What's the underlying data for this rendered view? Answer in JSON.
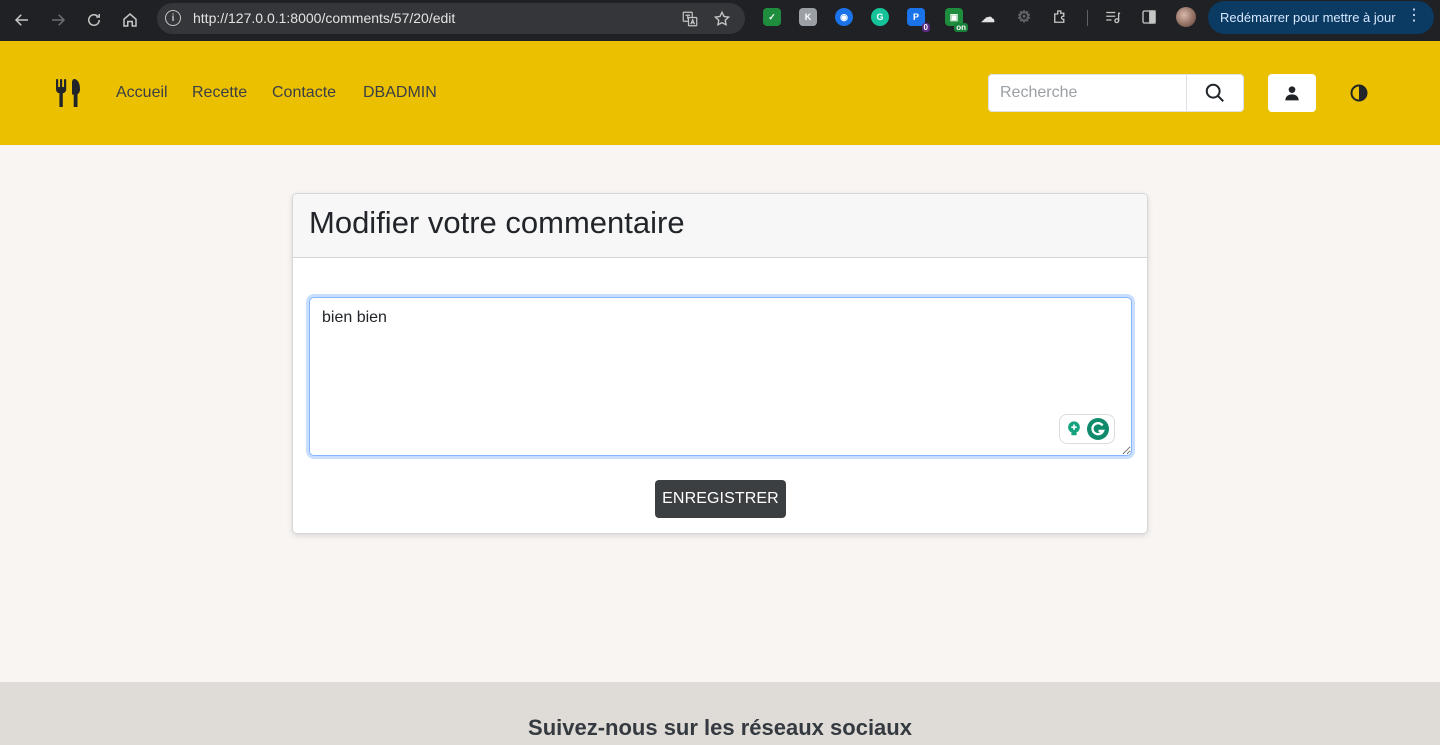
{
  "browser": {
    "url": "http://127.0.0.1:8000/comments/57/20/edit",
    "restart_label": "Redémarrer pour mettre à jour",
    "extensions": [
      {
        "name": "check-mail-extension-icon",
        "color": "#1e8e3e"
      },
      {
        "name": "k-extension-icon",
        "color": "#9aa0a6"
      },
      {
        "name": "compass-extension-icon",
        "color": "#1a73e8"
      },
      {
        "name": "grammarly-extension-icon",
        "color": "#15c39a"
      },
      {
        "name": "p-extension-icon",
        "color": "#1a73e8",
        "badge": "0",
        "badge_color": "#5a2a82"
      },
      {
        "name": "chat-extension-icon",
        "color": "#1e8e3e",
        "badge": "on",
        "badge_color": "#188038"
      },
      {
        "name": "cloud-extension-icon",
        "color": "#e3e3e3"
      },
      {
        "name": "gear-extension-icon",
        "color": "#5f6368"
      }
    ]
  },
  "header": {
    "nav": [
      "Accueil",
      "Recette",
      "Contacte",
      "DBADMIN"
    ],
    "search_placeholder": "Recherche",
    "accent_color": "#ebc000"
  },
  "card": {
    "title": "Modifier votre commentaire",
    "comment_value": "bien bien",
    "save_label": "ENREGISTRER"
  },
  "footer": {
    "title": "Suivez-nous sur les réseaux sociaux"
  }
}
